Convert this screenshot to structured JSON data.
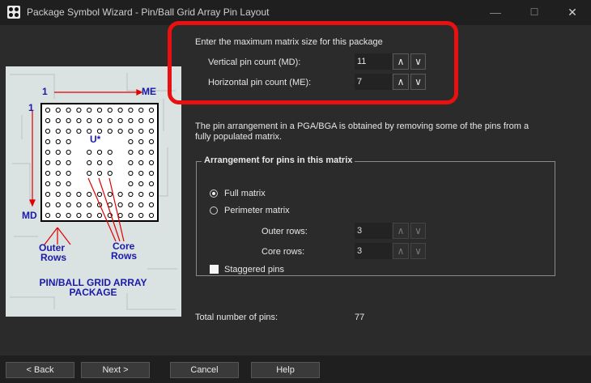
{
  "window": {
    "title": "Package Symbol Wizard - Pin/Ball Grid Array Pin Layout",
    "minimize_glyph": "—",
    "maximize_glyph": "☐",
    "close_glyph": "✕"
  },
  "illustration": {
    "col_start": "1",
    "col_end": "ME",
    "row_start": "1",
    "row_end": "MD",
    "chip_label": "U*",
    "outer_rows_line1": "Outer",
    "outer_rows_line2": "Rows",
    "core_rows_line1": "Core",
    "core_rows_line2": "Rows",
    "caption_line1": "PIN/BALL GRID ARRAY",
    "caption_line2": "PACKAGE"
  },
  "matrix": {
    "heading": "Enter the maximum matrix size for this package",
    "vertical_label": "Vertical pin count (MD):",
    "vertical_value": "11",
    "horizontal_label": "Horizontal pin count (ME):",
    "horizontal_value": "7"
  },
  "spin_up_glyph": "∧",
  "spin_down_glyph": "∨",
  "description": {
    "line1": "The pin arrangement in a PGA/BGA is obtained by removing some of the pins from a",
    "line2": "fully populated matrix."
  },
  "arrangement": {
    "title": "Arrangement for pins in this matrix",
    "full_matrix_label": "Full matrix",
    "full_matrix_selected": true,
    "perimeter_label": "Perimeter matrix",
    "outer_rows_label": "Outer rows:",
    "outer_rows_value": "3",
    "core_rows_label": "Core rows:",
    "core_rows_value": "3",
    "staggered_label": "Staggered pins"
  },
  "total": {
    "label": "Total number of pins:",
    "value": "77"
  },
  "footer": {
    "back_label": "< Back",
    "next_label": "Next >",
    "cancel_label": "Cancel",
    "help_label": "Help"
  }
}
